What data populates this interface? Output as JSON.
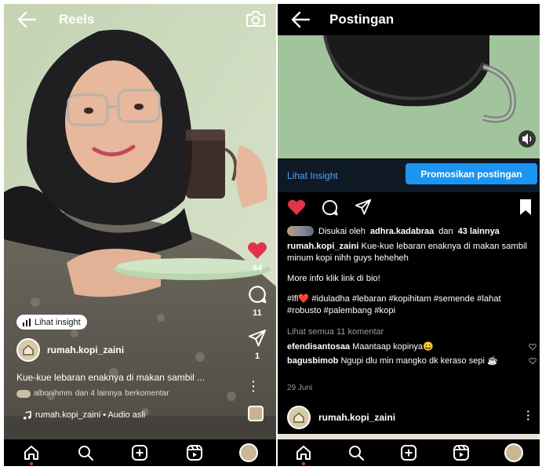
{
  "reels": {
    "title": "Reels",
    "likes_count": "44",
    "comments_count": "11",
    "shares_count": "1",
    "insight_label": "Lihat insight",
    "username": "rumah.kopi_zaini",
    "caption": "Kue-kue lebaran enaknya di makan sambil ...",
    "commenters_user": "albonihmm",
    "commenters_rest": "dan 4 lainnya",
    "commenters_suffix": "berkomentar",
    "audio": "rumah.kopi_zaini • Audio asli"
  },
  "post": {
    "title": "Postingan",
    "insight_link": "Lihat Insight",
    "promote_button": "Promosikan postingan",
    "liked_prefix": "Disukai oleh",
    "liked_user": "adhra.kadabraa",
    "liked_and": "dan",
    "liked_others": "43 lainnya",
    "username": "rumah.kopi_zaini",
    "caption": "Kue-kue lebaran enaknya di makan sambil minum kopi nihh guys heheheh",
    "more_info": "More info klik link di bio!",
    "hashtags": "#lfl❤️ #iduladha #lebaran #kopihitam #semende #lahat #robusto #palembang #kopi",
    "view_comments": "Lihat semua 11 komentar",
    "comments": [
      {
        "user": "efendisantosaa",
        "text": "Maantaap kopinya😀"
      },
      {
        "user": "bagusbimob",
        "text": "Ngupi dlu min mangko dk keraso sepi ☕"
      }
    ],
    "date": "29 Juni",
    "footer_username": "rumah.kopi_zaini"
  },
  "colors": {
    "like_red": "#e0334c",
    "promote_blue": "#1b95f0",
    "insight_blue": "#4aa3ff"
  },
  "icons": [
    "back-arrow-icon",
    "camera-icon",
    "heart-icon",
    "comment-icon",
    "share-icon",
    "bookmark-icon",
    "chart-icon",
    "music-icon",
    "home-icon",
    "search-icon",
    "add-icon",
    "reels-icon",
    "volume-icon"
  ]
}
